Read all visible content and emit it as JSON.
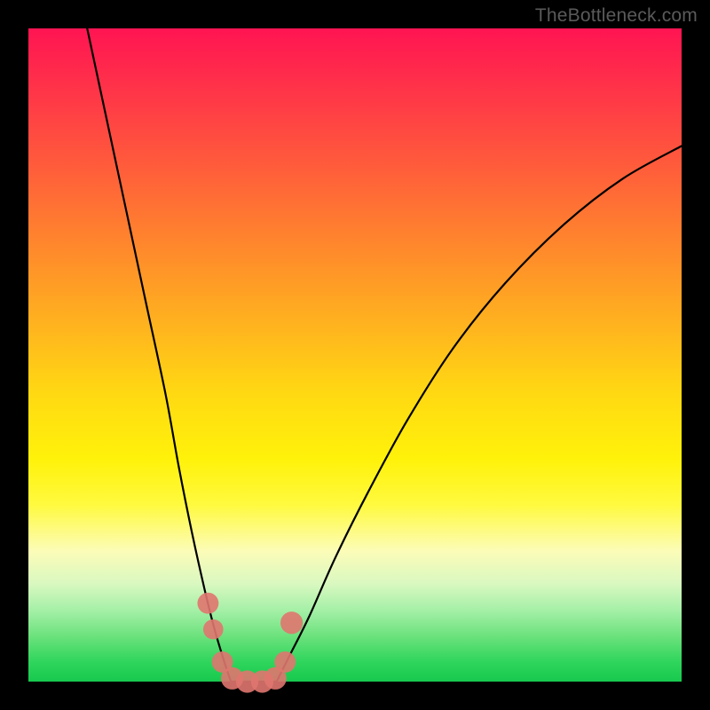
{
  "watermark": "TheBottleneck.com",
  "chart_data": {
    "type": "line",
    "title": "",
    "xlabel": "",
    "ylabel": "",
    "xlim": [
      0,
      100
    ],
    "ylim": [
      0,
      100
    ],
    "grid": false,
    "series": [
      {
        "name": "left-branch",
        "color": "#000000",
        "x": [
          9,
          12,
          15,
          18,
          21,
          23,
          25,
          27,
          28.5,
          30,
          31
        ],
        "y": [
          100,
          86,
          72,
          58,
          44,
          33,
          23,
          14,
          8,
          3,
          0
        ]
      },
      {
        "name": "right-branch",
        "color": "#000000",
        "x": [
          38,
          40,
          43,
          47,
          52,
          58,
          65,
          73,
          82,
          91,
          100
        ],
        "y": [
          0,
          4,
          10,
          19,
          29,
          40,
          51,
          61,
          70,
          77,
          82
        ]
      },
      {
        "name": "valley-floor",
        "color": "#000000",
        "x": [
          31,
          33,
          35,
          37,
          38
        ],
        "y": [
          0,
          0,
          0,
          0,
          0
        ]
      }
    ],
    "markers": [
      {
        "name": "dot",
        "x": 27.5,
        "y": 12,
        "r": 1.2,
        "color": "#e0766f"
      },
      {
        "name": "dot",
        "x": 28.3,
        "y": 8,
        "r": 1.1,
        "color": "#e0766f"
      },
      {
        "name": "dot",
        "x": 29.7,
        "y": 3,
        "r": 1.2,
        "color": "#e0766f"
      },
      {
        "name": "dot",
        "x": 31.2,
        "y": 0.5,
        "r": 1.3,
        "color": "#e0766f"
      },
      {
        "name": "dot",
        "x": 33.5,
        "y": 0,
        "r": 1.3,
        "color": "#e0766f"
      },
      {
        "name": "dot",
        "x": 35.8,
        "y": 0,
        "r": 1.3,
        "color": "#e0766f"
      },
      {
        "name": "dot",
        "x": 37.8,
        "y": 0.5,
        "r": 1.3,
        "color": "#e0766f"
      },
      {
        "name": "dot",
        "x": 39.3,
        "y": 3,
        "r": 1.2,
        "color": "#e0766f"
      },
      {
        "name": "dot",
        "x": 40.3,
        "y": 9,
        "r": 1.3,
        "color": "#e0766f"
      }
    ],
    "colors": {
      "curve": "#000000",
      "marker": "#e0766f",
      "gradient_top": "#ff1452",
      "gradient_mid": "#fff20a",
      "gradient_bottom": "#17c94e",
      "frame": "#000000"
    }
  }
}
